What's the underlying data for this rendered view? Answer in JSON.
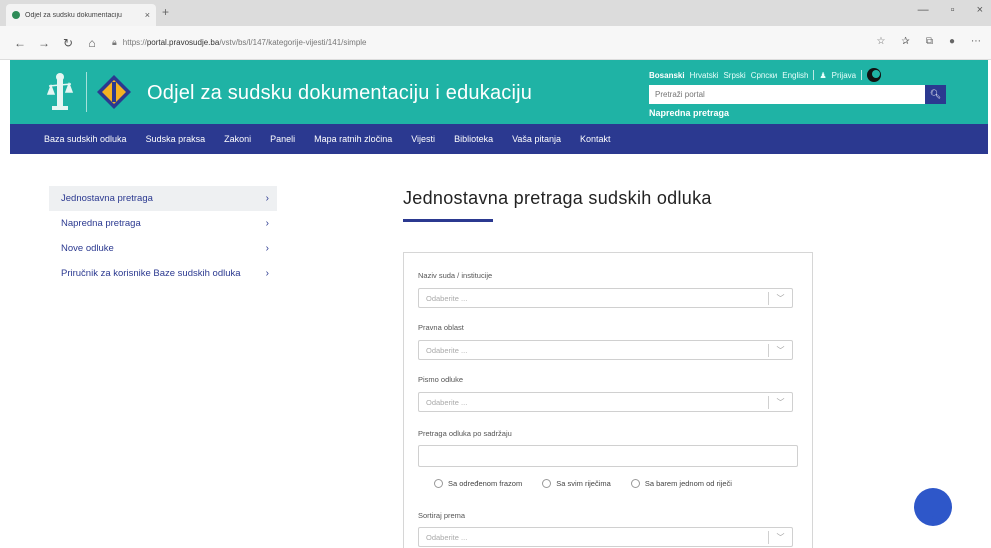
{
  "browser": {
    "tab_title": "Odjel za sudsku dokumentaciju",
    "tab_close": "×",
    "new_tab": "+",
    "url_prefix": "https://",
    "url_domain": "portal.pravosudje.ba",
    "url_path": "/vstv/bs/l/147/kategorije-vijesti/141/simple",
    "window_controls": [
      "—",
      "▫",
      "×"
    ]
  },
  "header": {
    "site_title": "Odjel za sudsku dokumentaciju i edukaciju",
    "languages": [
      "Bosanski",
      "Hrvatski",
      "Srpski",
      "Српски",
      "English"
    ],
    "login_label": "Prijava",
    "search_placeholder": "Pretraži portal",
    "advanced_search_link": "Napredna pretraga",
    "accent_color": "#1fb3a5",
    "nav_color": "#2b3990"
  },
  "nav": {
    "items": [
      "Baza sudskih odluka",
      "Sudska praksa",
      "Zakoni",
      "Paneli",
      "Mapa ratnih zločina",
      "Vijesti",
      "Biblioteka",
      "Vaša pitanja",
      "Kontakt"
    ]
  },
  "sidebar": {
    "items": [
      {
        "label": "Jednostavna pretraga"
      },
      {
        "label": "Napredna pretraga"
      },
      {
        "label": "Nove odluke"
      },
      {
        "label": "Priručnik za korisnike Baze sudskih odluka"
      }
    ]
  },
  "main": {
    "title": "Jednostavna pretraga sudskih odluka",
    "fields": {
      "court_label": "Naziv suda / institucije",
      "court_placeholder": "Odaberite ...",
      "area_label": "Pravna oblast",
      "area_placeholder": "Odaberite ...",
      "script_label": "Pismo odluke",
      "script_placeholder": "Odaberite ...",
      "content_label": "Pretraga odluka po sadržaju",
      "sort_label": "Sortiraj prema",
      "sort_placeholder": "Odaberite ..."
    },
    "radios": [
      "Sa određenom frazom",
      "Sa svim riječima",
      "Sa barem jednom od riječi"
    ]
  }
}
